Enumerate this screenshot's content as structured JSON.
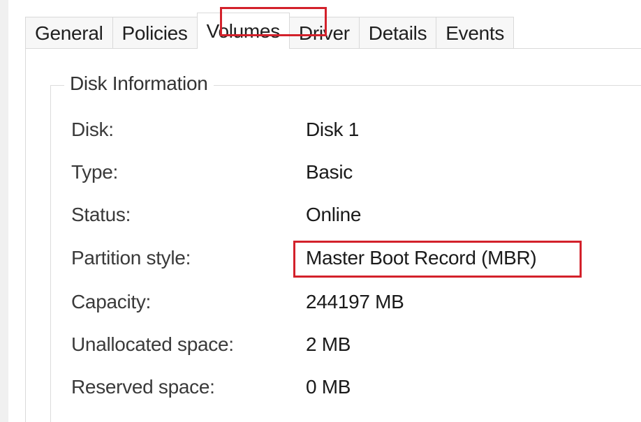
{
  "tabs": [
    {
      "label": "General"
    },
    {
      "label": "Policies"
    },
    {
      "label": "Volumes"
    },
    {
      "label": "Driver"
    },
    {
      "label": "Details"
    },
    {
      "label": "Events"
    }
  ],
  "selected_tab": "Volumes",
  "highlight_color": "#d3212b",
  "disk_information": {
    "title": "Disk Information",
    "rows": [
      {
        "label": "Disk:",
        "value": "Disk 1"
      },
      {
        "label": "Type:",
        "value": "Basic"
      },
      {
        "label": "Status:",
        "value": "Online"
      },
      {
        "label": "Partition style:",
        "value": "Master Boot Record (MBR)"
      },
      {
        "label": "Capacity:",
        "value": "244197 MB"
      },
      {
        "label": "Unallocated space:",
        "value": "2 MB"
      },
      {
        "label": "Reserved space:",
        "value": "0 MB"
      }
    ]
  }
}
